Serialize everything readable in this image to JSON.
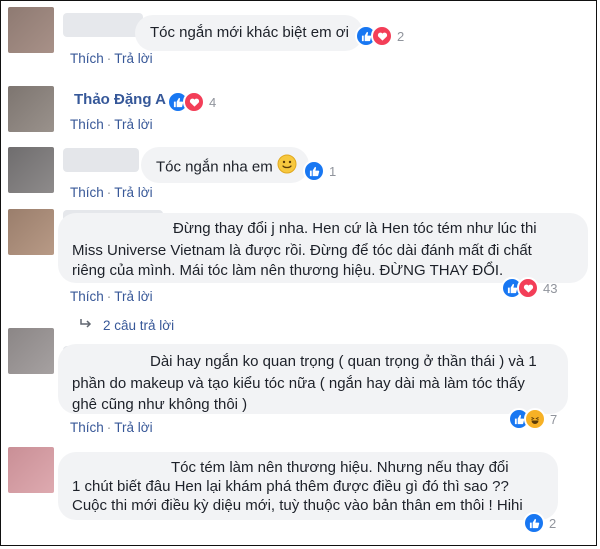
{
  "comments": [
    {
      "text": "Tóc ngắn mới khác biệt em ơi",
      "react_count": "2",
      "reactions": [
        "like",
        "love"
      ]
    },
    {
      "author": "Thảo Đặng A",
      "react_count": "4",
      "reactions": [
        "like",
        "love"
      ]
    },
    {
      "text": "Tóc ngắn nha em",
      "react_count": "1",
      "reactions": [
        "like"
      ]
    },
    {
      "lines": [
        "Đừng thay đổi j nha. Hen cứ là Hen tóc tém như lúc thi",
        "Miss Universe Vietnam là được rồi. Đừng để tóc dài đánh mất đi chất",
        "riêng của mình. Mái tóc làm nên thương hiệu. ĐỪNG THAY ĐỔI."
      ],
      "react_count": "43",
      "reactions": [
        "like",
        "love"
      ]
    },
    {
      "lines": [
        "Dài hay ngắn ko quan trọng ( quan trọng ở thần thái ) và 1",
        "phần do makeup và tạo kiểu tóc nữa ( ngắn hay dài mà làm tóc thấy",
        "ghê cũng như không thôi )"
      ],
      "react_count": "7",
      "reactions": [
        "like",
        "haha"
      ]
    },
    {
      "lines": [
        "Tóc tém làm nên thương hiệu. Nhưng nếu thay đổi",
        "1 chút biết đâu Hen lại khám phá thêm được điều gì đó thì sao ??",
        "Cuộc thi mới điều kỳ diệu mới, tuỳ thuộc vào bản thân em thôi ! Hihi"
      ],
      "react_count": "2",
      "reactions": [
        "like"
      ]
    }
  ],
  "actions": {
    "like": "Thích",
    "reply": "Trả lời",
    "separator": "·"
  },
  "replies_link": "2 câu trả lời",
  "colors": {
    "link": "#385898",
    "name": "#365899",
    "like": "#1877f2",
    "love": "#f33e58",
    "haha": "#f7b125",
    "bubble": "#f2f3f5"
  },
  "icons": [
    "like-icon",
    "love-icon",
    "haha-icon",
    "smile-emoji-icon",
    "reply-arrow-icon"
  ]
}
